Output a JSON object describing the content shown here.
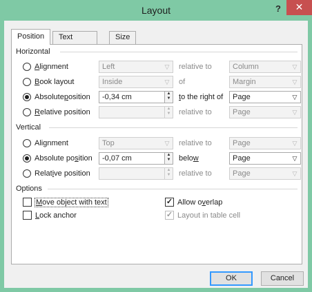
{
  "window": {
    "title": "Layout",
    "help": "?",
    "close": "✕"
  },
  "tabs": [
    "Position",
    "Text Wrapping",
    "Size"
  ],
  "horizontal": {
    "title": "Horizontal",
    "rows": [
      {
        "label_pre": "",
        "label_u": "A",
        "label_post": "lignment",
        "value": "Left",
        "relation": "relative to",
        "relative_value": "Column"
      },
      {
        "label_pre": "",
        "label_u": "B",
        "label_post": "ook layout",
        "value": "Inside",
        "relation": "of",
        "relative_value": "Margin"
      },
      {
        "label_pre": "Absolute ",
        "label_u": "p",
        "label_post": "osition",
        "value": "-0,34 cm",
        "relation_u": "t",
        "relation_post": "o the right of",
        "relative_value": "Page"
      },
      {
        "label_pre": "",
        "label_u": "R",
        "label_post": "elative position",
        "value": "",
        "relation": "relative to",
        "relative_value": "Page"
      }
    ]
  },
  "vertical": {
    "title": "Vertical",
    "rows": [
      {
        "label_pre": "Ali",
        "label_u": "g",
        "label_post": "nment",
        "value": "Top",
        "relation": "relative to",
        "relative_value": "Page"
      },
      {
        "label_pre": "Absolute po",
        "label_u": "s",
        "label_post": "ition",
        "value": "-0,07 cm",
        "relation_pre": "belo",
        "relation_u": "w",
        "relative_value": "Page"
      },
      {
        "label_pre": "Relat",
        "label_u": "i",
        "label_post": "ve position",
        "value": "",
        "relation": "relative to",
        "relative_value": "Page"
      }
    ]
  },
  "options": {
    "title": "Options",
    "move_u": "M",
    "move_post": "ove object with text",
    "lock_u": "L",
    "lock_post": "ock anchor",
    "overlap_pre": "Allow o",
    "overlap_u": "v",
    "overlap_post": "erlap",
    "layout_in_cell": "Layout in table cell"
  },
  "buttons": {
    "ok": "OK",
    "cancel": "Cancel"
  }
}
